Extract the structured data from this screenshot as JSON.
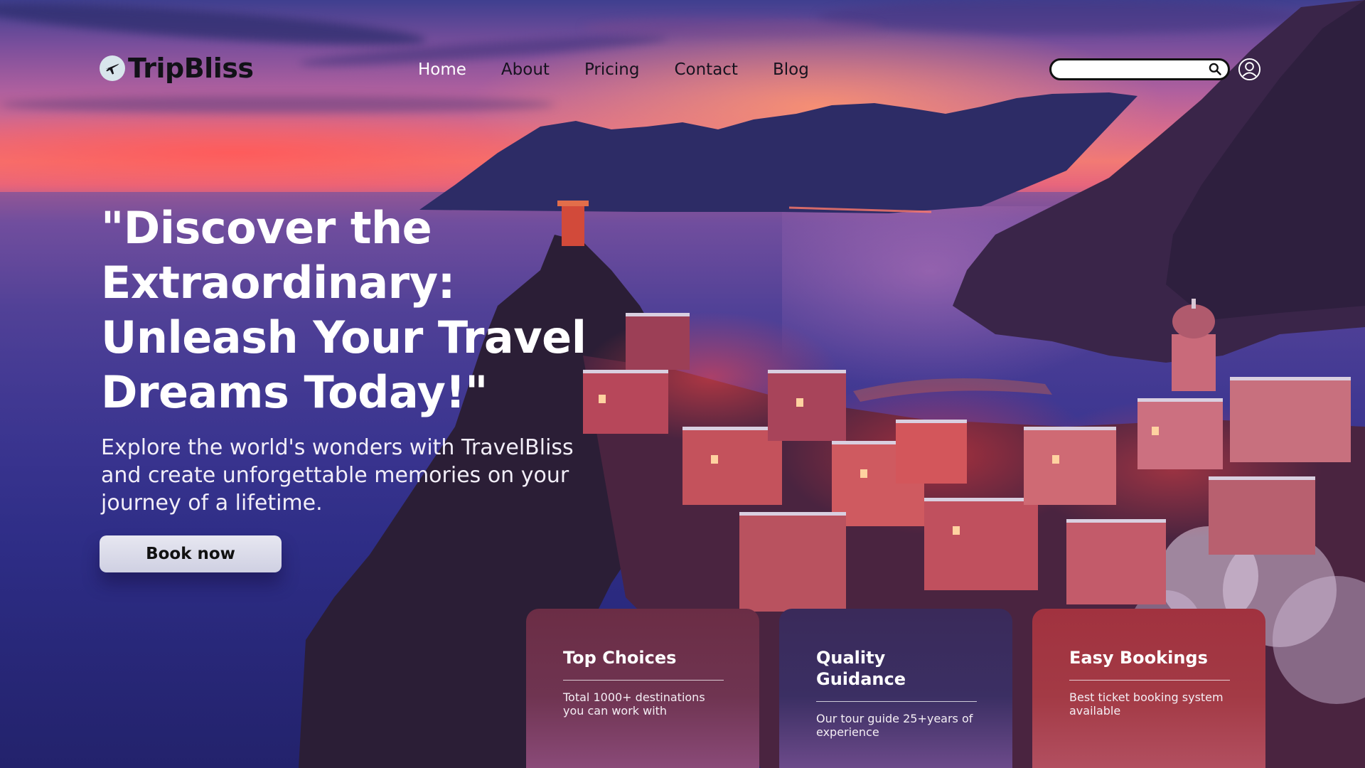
{
  "brand": {
    "name": "TripBliss",
    "logo_icon": "airplane-globe-icon"
  },
  "nav": {
    "items": [
      {
        "label": "Home",
        "active": true
      },
      {
        "label": "About",
        "active": false
      },
      {
        "label": "Pricing",
        "active": false
      },
      {
        "label": "Contact",
        "active": false
      },
      {
        "label": "Blog",
        "active": false
      }
    ]
  },
  "search": {
    "value": "",
    "icon": "search-icon"
  },
  "account": {
    "icon": "user-icon"
  },
  "hero": {
    "headline": "\"Discover the Extraordinary: Unleash Your Travel Dreams Today!\"",
    "subheadline": "Explore the world's wonders with TravelBliss and create unforgettable memories on your journey of a lifetime.",
    "cta_label": "Book now"
  },
  "features": [
    {
      "title": "Top Choices",
      "text": "Total 1000+ destinations you can work with"
    },
    {
      "title": "Quality Guidance",
      "text": "Our tour guide 25+years of experience"
    },
    {
      "title": "Easy Bookings",
      "text": "Best ticket booking system available"
    }
  ],
  "colors": {
    "card_1": "#6b2d45",
    "card_2": "#3a2a5a",
    "card_3": "#a1323f",
    "cta_bg": "#dcdceb",
    "nav_active": "#ffffff",
    "nav_text": "#16131f"
  }
}
